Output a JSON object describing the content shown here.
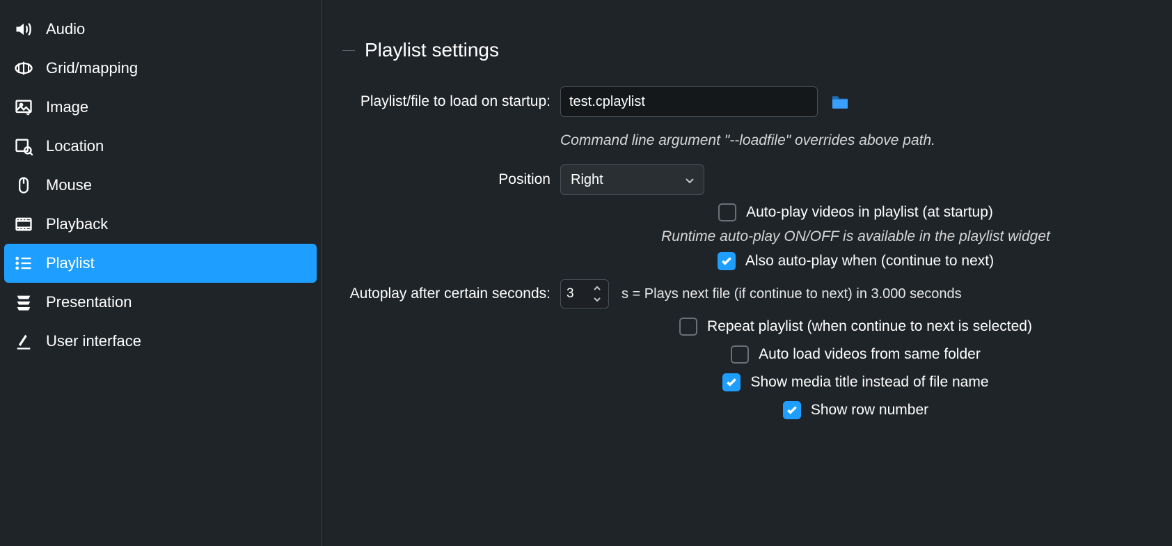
{
  "sidebar": {
    "items": [
      {
        "id": "audio",
        "label": "Audio"
      },
      {
        "id": "grid-mapping",
        "label": "Grid/mapping"
      },
      {
        "id": "image",
        "label": "Image"
      },
      {
        "id": "location",
        "label": "Location"
      },
      {
        "id": "mouse",
        "label": "Mouse"
      },
      {
        "id": "playback",
        "label": "Playback"
      },
      {
        "id": "playlist",
        "label": "Playlist",
        "selected": true
      },
      {
        "id": "presentation",
        "label": "Presentation"
      },
      {
        "id": "user-interface",
        "label": "User interface"
      }
    ]
  },
  "main": {
    "section_title": "Playlist settings",
    "startup_file_label": "Playlist/file to load on startup:",
    "startup_file_value": "test.cplaylist",
    "startup_file_hint": "Command line argument \"--loadfile\" overrides above path.",
    "position_label": "Position",
    "position_value": "Right",
    "autoplay_at_startup_label": "Auto-play videos in playlist (at startup)",
    "autoplay_at_startup_checked": false,
    "autoplay_runtime_hint": "Runtime auto-play ON/OFF is available in the playlist widget",
    "also_autoplay_label": "Also auto-play when (continue to next)",
    "also_autoplay_checked": true,
    "autoplay_seconds_label": "Autoplay after certain seconds:",
    "autoplay_seconds_value": "3",
    "autoplay_seconds_suffix": "s = Plays next file (if continue to next) in 3.000 seconds",
    "repeat_playlist_label": "Repeat playlist (when continue to next is selected)",
    "repeat_playlist_checked": false,
    "autoload_same_folder_label": "Auto load videos from same folder",
    "autoload_same_folder_checked": false,
    "show_media_title_label": "Show media title instead of file name",
    "show_media_title_checked": true,
    "show_row_number_label": "Show row number",
    "show_row_number_checked": true
  }
}
